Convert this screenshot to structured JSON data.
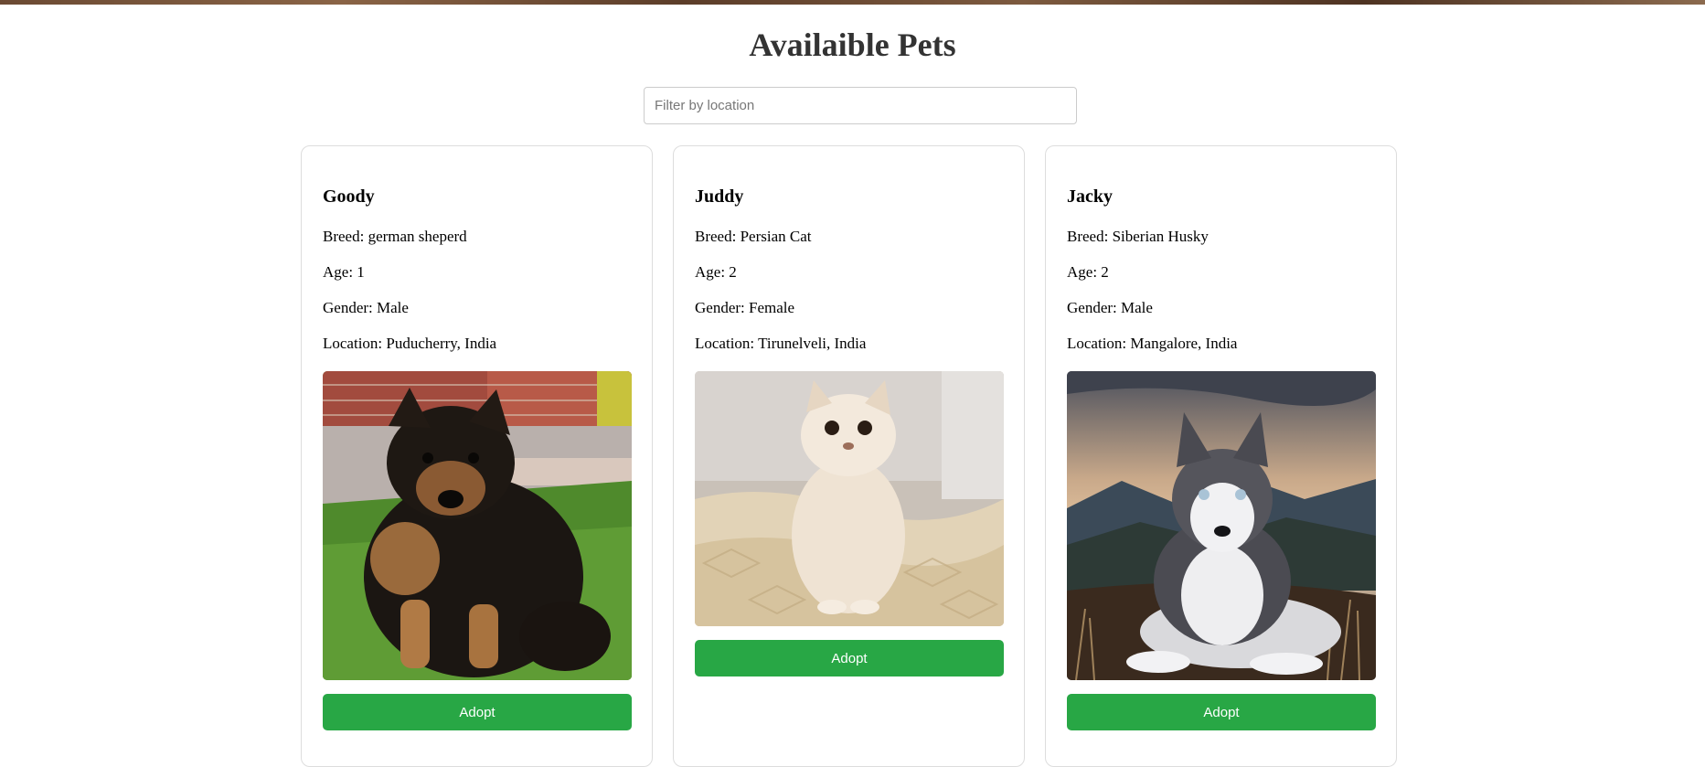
{
  "page": {
    "title": "Availaible Pets"
  },
  "filter": {
    "placeholder": "Filter by location",
    "value": ""
  },
  "labels": {
    "breed": "Breed: ",
    "age": "Age: ",
    "gender": "Gender: ",
    "location": "Location: "
  },
  "pets": [
    {
      "name": "Goody",
      "breed": "german sheperd",
      "age": "1",
      "gender": "Male",
      "location": "Puducherry, India",
      "adopt_label": "Adopt"
    },
    {
      "name": "Juddy",
      "breed": "Persian Cat",
      "age": "2",
      "gender": "Female",
      "location": "Tirunelveli, India",
      "adopt_label": "Adopt"
    },
    {
      "name": "Jacky",
      "breed": "Siberian Husky",
      "age": "2",
      "gender": "Male",
      "location": "Mangalore, India",
      "adopt_label": "Adopt"
    }
  ],
  "colors": {
    "adopt_button": "#28a745",
    "title": "#333333",
    "card_border": "#dddddd"
  }
}
